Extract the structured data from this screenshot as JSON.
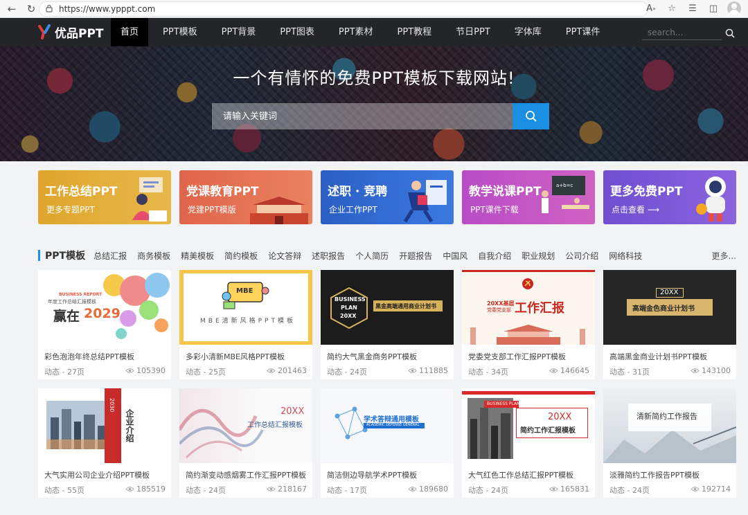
{
  "browser": {
    "url": "https://www.ypppt.com"
  },
  "site": {
    "logo_text": "优品PPT",
    "nav": [
      "首页",
      "PPT模板",
      "PPT背景",
      "PPT图表",
      "PPT素材",
      "PPT教程",
      "节日PPT",
      "字体库",
      "PPT课件"
    ],
    "nav_search_placeholder": "search...",
    "colors": {
      "nav_bg": "#232528",
      "accent": "#1a8ee2"
    }
  },
  "hero": {
    "title": "一个有情怀的免费PPT模板下载网站!",
    "search_placeholder": "请输入关键词"
  },
  "banners": [
    {
      "title": "工作总结PPT",
      "subtitle": "更多专题PPT",
      "color": "#e3a930"
    },
    {
      "title": "党课教育PPT",
      "subtitle": "党建PPT模版",
      "color": "#e06a4c"
    },
    {
      "title": "述职 · 竞聘",
      "subtitle": "企业工作PPT",
      "color": "#2f67c9"
    },
    {
      "title": "教学说课PPT",
      "subtitle": "PPT课件下载",
      "color": "#c04fc0"
    },
    {
      "title": "更多免费PPT",
      "subtitle": "点击查看 ⟶",
      "color": "#7a56d6"
    }
  ],
  "section": {
    "title": "PPT模板",
    "categories": [
      "总结汇报",
      "商务模板",
      "精美模板",
      "简约模板",
      "论文答辩",
      "述职报告",
      "个人简历",
      "开题报告",
      "中国风",
      "自我介绍",
      "职业规划",
      "公司介绍",
      "网络科技"
    ],
    "more": "更多..."
  },
  "templates": [
    {
      "name": "彩色泡泡年终总结PPT模板",
      "meta": "动态 - 27页",
      "views": "105390",
      "thumb_text": [
        "BUSINESS REPORT",
        "年度工作总结汇报模板",
        "赢在",
        "2029"
      ]
    },
    {
      "name": "多彩小清新MBE风格PPT模板",
      "meta": "动态 - 25页",
      "views": "201463",
      "thumb_text": [
        "MBE",
        "MBE清新风格PPT模板"
      ]
    },
    {
      "name": "简约大气黑金商务PPT模板",
      "meta": "动态 - 24页",
      "views": "111885",
      "thumb_text": [
        "BUSINESS",
        "PLAN",
        "20XX",
        "黑金高端通用商业计划书"
      ]
    },
    {
      "name": "党委党支部工作汇报PPT模板",
      "meta": "动态 - 34页",
      "views": "146645",
      "thumb_text": [
        "20XX基层",
        "党委党支部",
        "工作汇报"
      ]
    },
    {
      "name": "高端黑金商业计划书PPT模板",
      "meta": "动态 - 31页",
      "views": "143100",
      "thumb_text": [
        "20XX",
        "高端金色商业计划书"
      ]
    },
    {
      "name": "大气实用公司企业介绍PPT模板",
      "meta": "动态 - 55页",
      "views": "185519",
      "thumb_text": [
        "企业介绍",
        "2030"
      ]
    },
    {
      "name": "简约渐变动感烟雾工作汇报PPT模板",
      "meta": "动态 - 24页",
      "views": "218167",
      "thumb_text": [
        "20XX",
        "工作总结汇报模板"
      ]
    },
    {
      "name": "简洁侧边导航学术PPT模板",
      "meta": "动态 - 17页",
      "views": "189680",
      "thumb_text": [
        "学术答辩通用模板",
        "ACADEMIC DEFENSE GENERAL"
      ]
    },
    {
      "name": "大气红色工作总结汇报PPT模板",
      "meta": "动态 - 24页",
      "views": "165831",
      "thumb_text": [
        "BUSINESS PLAN",
        "20XX",
        "简约工作汇报模板"
      ]
    },
    {
      "name": "淡雅简约工作报告PPT模板",
      "meta": "动态 - 24页",
      "views": "192714",
      "thumb_text": [
        "清新简约工作报告"
      ]
    }
  ]
}
